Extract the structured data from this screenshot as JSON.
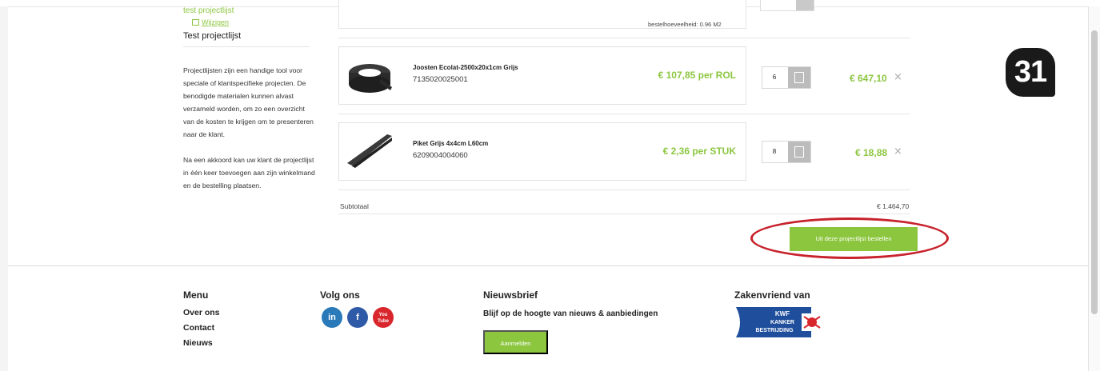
{
  "sidebar": {
    "project_link": "test projectlijst",
    "edit_label": "Wijzigen",
    "project_title": "Test projectlijst",
    "description_1": "Projectlijsten zijn een handige tool voor speciale of klantspecifieke projecten. De benodigde materialen kunnen alvast verzameld worden, om zo een overzicht van de kosten te krijgen om te presenteren naar de klant.",
    "description_2": "Na een akkoord kan uw klant de projectlijst in één keer toevoegen aan zijn winkelmand en de bestelling plaatsen."
  },
  "top_row": {
    "order_quantity": "bestelhoeveelheid: 0.96 M2"
  },
  "products": [
    {
      "name": "Joosten Ecolat-2500x20x1cm Grijs",
      "code": "7135020025001",
      "price": "€ 107,85 per ROL",
      "quantity": "6",
      "total": "€ 647,10",
      "image_icon": "roll-product-icon"
    },
    {
      "name": "Piket Grijs 4x4cm L60cm",
      "code": "6209004004060",
      "price": "€ 2,36 per STUK",
      "quantity": "8",
      "total": "€ 18,88",
      "image_icon": "stake-product-icon"
    }
  ],
  "remove_symbol": "×",
  "subtotal": {
    "label": "Subtotaal",
    "value": "€ 1.464,70"
  },
  "order_button_label": "Uit deze projectlijst bestellen",
  "footer": {
    "menu_heading": "Menu",
    "menu_items": [
      "Over ons",
      "Contact",
      "Nieuws"
    ],
    "follow_heading": "Volg ons",
    "social": [
      {
        "label": "in",
        "color": "#2a7ab9",
        "icon": "linkedin-icon"
      },
      {
        "label": "f",
        "color": "#2f5aa8",
        "icon": "facebook-icon"
      },
      {
        "label": "You Tube",
        "color": "#d8262c",
        "icon": "youtube-icon"
      }
    ],
    "newsletter_heading": "Nieuwsbrief",
    "newsletter_text": "Blijf op de hoogte van nieuws & aanbiedingen",
    "subscribe_label": "Aanmelden",
    "partner_heading": "Zakenvriend van",
    "partner_logo_lines": [
      "KWF",
      "KANKER",
      "BESTRIJDING"
    ]
  },
  "step_badge": "31",
  "colors": {
    "accent_green": "#8cc63f",
    "highlight_red": "#c8222c"
  }
}
